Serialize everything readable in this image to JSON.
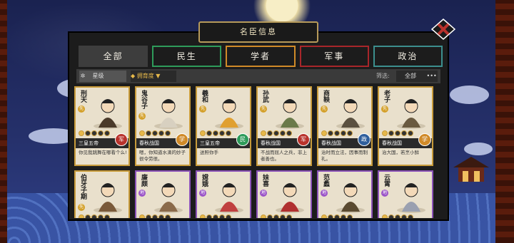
{
  "header": {
    "title": "名臣信息"
  },
  "tabs": [
    {
      "label": "全部",
      "color": "#3d3d3d",
      "active": true
    },
    {
      "label": "民生",
      "color": "#2e9b5a",
      "active": false
    },
    {
      "label": "学者",
      "color": "#d08a28",
      "active": false
    },
    {
      "label": "军事",
      "color": "#a8262a",
      "active": false
    },
    {
      "label": "政治",
      "color": "#3c8f8e",
      "active": false
    }
  ],
  "filters": {
    "star_label": "星级",
    "loyalty_label": "拥育度",
    "filter_label": "筛选:",
    "filter_value": "全部",
    "more": "•••"
  },
  "cards": [
    {
      "name": "刑天",
      "badge": "先",
      "era": "三皇五帝",
      "cat": "军",
      "cat_color": "#b8322c",
      "desc": "你见我跳舞在哪看个么!",
      "frame": "gold"
    },
    {
      "name": "鬼谷子",
      "badge": "先",
      "era": "春秋战国",
      "cat": "学",
      "cat_color": "#d08a28",
      "desc": "嗯，你知道水滴的妙子很令劳很。",
      "frame": "gold"
    },
    {
      "name": "羲和",
      "badge": "先",
      "era": "三皇五帝",
      "cat": "民",
      "cat_color": "#2e9b5a",
      "desc": "送照你手",
      "frame": "gold"
    },
    {
      "name": "孙武",
      "badge": "先",
      "era": "春秋战国",
      "cat": "军",
      "cat_color": "#b8322c",
      "desc": "不战而屈人之兵，非上者善也。",
      "frame": "gold"
    },
    {
      "name": "商鞅",
      "badge": "先",
      "era": "春秋战国",
      "cat": "政",
      "cat_color": "#2f5f9c",
      "desc": "治时而立法，因事而制礼。",
      "frame": "gold"
    },
    {
      "name": "老子",
      "badge": "先",
      "era": "春秋战国",
      "cat": "学",
      "cat_color": "#d08a28",
      "desc": "治大国，若烹小鲜",
      "frame": "gold"
    },
    {
      "name": "伯牙子期",
      "badge": "先",
      "era": "",
      "cat": "",
      "cat_color": "",
      "desc": "",
      "frame": "gold"
    },
    {
      "name": "廉颇",
      "badge": "地",
      "era": "",
      "cat": "",
      "cat_color": "",
      "desc": "",
      "frame": "purple"
    },
    {
      "name": "嫦娥",
      "badge": "地",
      "era": "",
      "cat": "",
      "cat_color": "",
      "desc": "",
      "frame": "purple"
    },
    {
      "name": "妹喜",
      "badge": "地",
      "era": "",
      "cat": "",
      "cat_color": "",
      "desc": "",
      "frame": "purple"
    },
    {
      "name": "范蠡",
      "badge": "地",
      "era": "",
      "cat": "",
      "cat_color": "",
      "desc": "",
      "frame": "purple"
    },
    {
      "name": "云霄",
      "badge": "地",
      "era": "",
      "cat": "",
      "cat_color": "",
      "desc": "",
      "frame": "purple"
    }
  ]
}
